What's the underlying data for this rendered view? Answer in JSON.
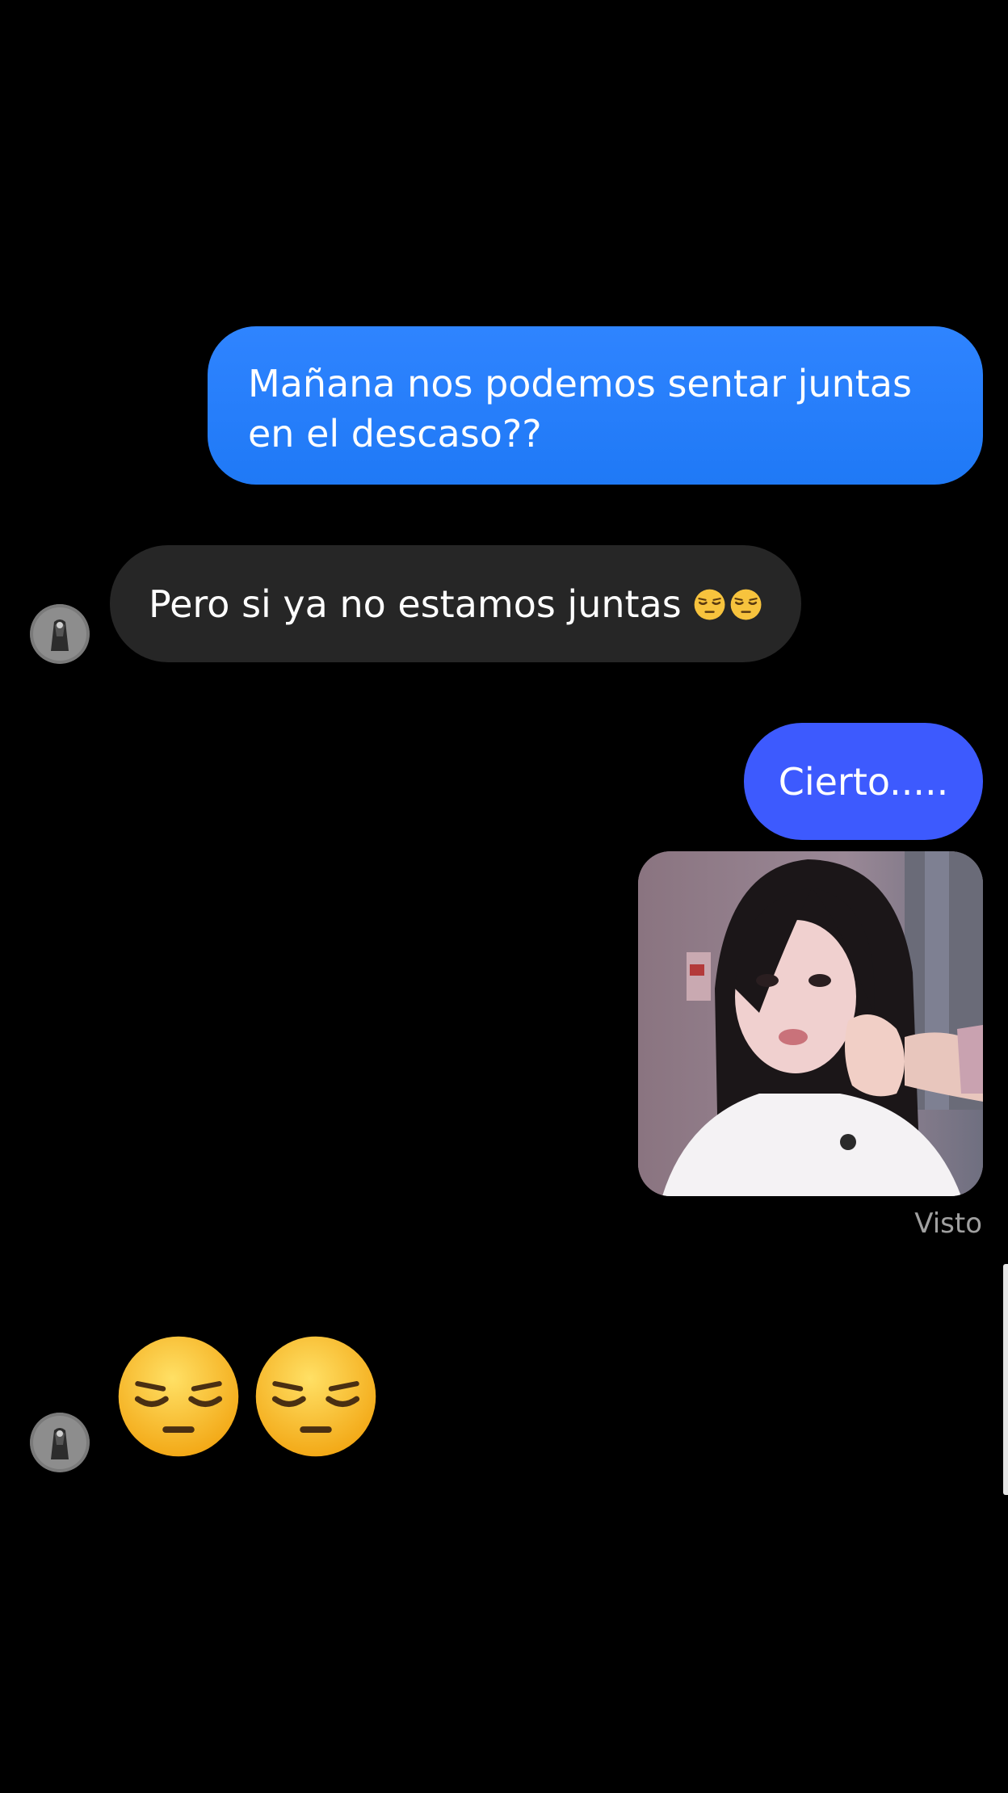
{
  "messages": {
    "out_1": "Mañana nos podemos sentar juntas en el descaso??",
    "in_1": "Pero si ya no estamos juntas",
    "out_2": "Cierto.....",
    "seen_label": "Visto"
  },
  "icons": {
    "avatar": "avatar-icon",
    "pensive": "pensive-face-emoji",
    "photo": "shared-photo"
  },
  "colors": {
    "background": "#000000",
    "outgoing_bubble": "#2f84ff",
    "outgoing_bubble_alt": "#3d5afe",
    "incoming_bubble": "#262626",
    "seen_text": "#a0a0a0"
  }
}
